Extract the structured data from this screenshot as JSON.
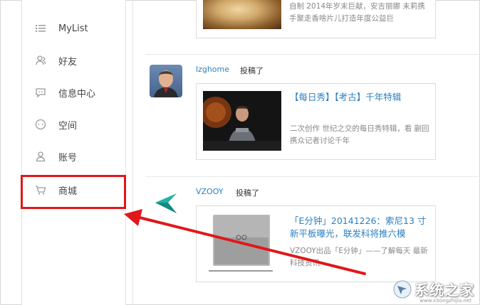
{
  "sidebar": {
    "items": [
      {
        "label": "MyList",
        "icon": "list-icon"
      },
      {
        "label": "好友",
        "icon": "friends-icon"
      },
      {
        "label": "信息中心",
        "icon": "message-icon"
      },
      {
        "label": "空间",
        "icon": "space-icon"
      },
      {
        "label": "账号",
        "icon": "account-icon"
      },
      {
        "label": "商城",
        "icon": "cart-icon"
      }
    ]
  },
  "feed": {
    "top_card": {
      "desc": "自制 2014年岁末巨献，安吉丽娜 未莉携手聚走香啥片儿打造年度公益巨"
    },
    "posts": [
      {
        "author": "lzghome",
        "action": "投稿了",
        "title": "【每日秀】【考古】千年特辑",
        "desc": "二次创作 世纪之交的每日秀特辑，看 蒯回携众记者讨论千年"
      },
      {
        "author": "VZOOY",
        "action": "投稿了",
        "title": "「E分钟」20141226：索尼13 寸新平板曝光，联发科将推六模",
        "desc": "VZOOY出品「E分钟」——了解每天 最新科技资讯"
      }
    ]
  },
  "watermark": {
    "text": "系统之家",
    "sub": "www.xitongzhijia.net"
  },
  "colors": {
    "accent": "#2c7fc0",
    "highlight": "#e0171b"
  }
}
